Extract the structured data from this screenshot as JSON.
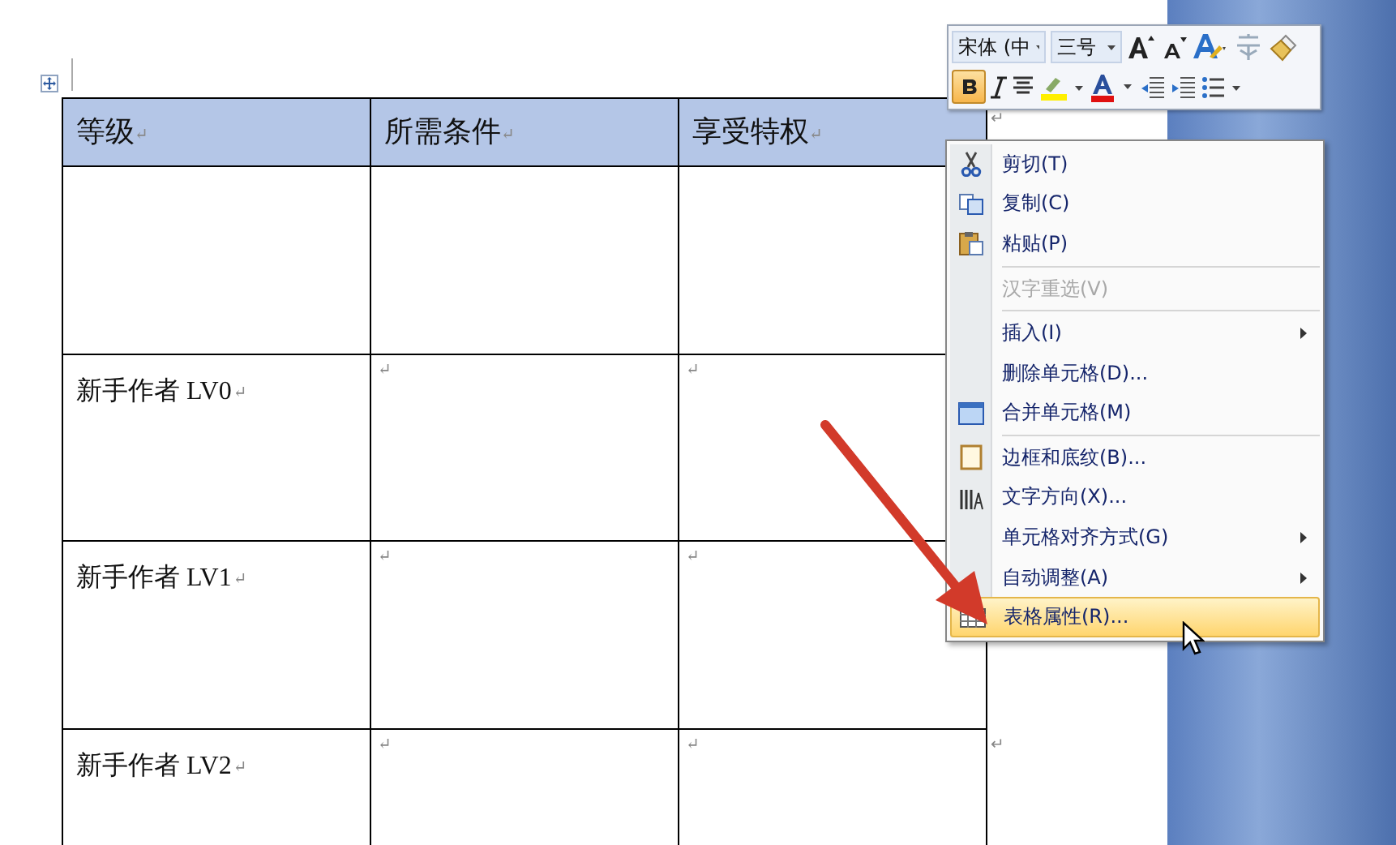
{
  "table": {
    "header": [
      {
        "text": "等级",
        "mark": "↵"
      },
      {
        "text": "所需条件",
        "mark": "↵"
      },
      {
        "text": "享受特权",
        "mark": "↵"
      }
    ],
    "rows": [
      {
        "cells": [
          {},
          {},
          {}
        ]
      },
      {
        "cells": [
          {
            "text": "新手作者 LV0",
            "mark": "↵"
          },
          {
            "mark": "↵"
          },
          {
            "mark": "↵"
          }
        ]
      },
      {
        "cells": [
          {
            "text": "新手作者 LV1",
            "mark": "↵"
          },
          {
            "mark": "↵"
          },
          {
            "mark": "↵"
          }
        ]
      },
      {
        "cells": [
          {
            "text": "新手作者 LV2",
            "mark": "↵"
          },
          {
            "mark": "↵"
          },
          {
            "mark": "↵"
          }
        ],
        "end_mark": "↵"
      }
    ],
    "header_end_mark": "↵"
  },
  "mini_toolbar": {
    "font": "宋体 (中",
    "size": "三号",
    "bold": true
  },
  "context_menu": {
    "items": [
      {
        "kind": "item",
        "label": "剪切(T)",
        "disabled": false,
        "submenu": false,
        "selected": false
      },
      {
        "kind": "item",
        "label": "复制(C)",
        "disabled": false,
        "submenu": false,
        "selected": false
      },
      {
        "kind": "item",
        "label": "粘贴(P)",
        "disabled": false,
        "submenu": false,
        "selected": false
      },
      {
        "kind": "separator"
      },
      {
        "kind": "item",
        "label": "汉字重选(V)",
        "disabled": true,
        "submenu": false,
        "selected": false
      },
      {
        "kind": "separator"
      },
      {
        "kind": "item",
        "label": "插入(I)",
        "disabled": false,
        "submenu": true,
        "selected": false
      },
      {
        "kind": "item",
        "label": "删除单元格(D)...",
        "disabled": false,
        "submenu": false,
        "selected": false
      },
      {
        "kind": "item",
        "label": "合并单元格(M)",
        "disabled": false,
        "submenu": false,
        "selected": false
      },
      {
        "kind": "separator"
      },
      {
        "kind": "item",
        "label": "边框和底纹(B)...",
        "disabled": false,
        "submenu": false,
        "selected": false
      },
      {
        "kind": "item",
        "label": "文字方向(X)...",
        "disabled": false,
        "submenu": false,
        "selected": false
      },
      {
        "kind": "item",
        "label": "单元格对齐方式(G)",
        "disabled": false,
        "submenu": true,
        "selected": false
      },
      {
        "kind": "item",
        "label": "自动调整(A)",
        "disabled": false,
        "submenu": true,
        "selected": false
      },
      {
        "kind": "item",
        "label": "表格属性(R)...",
        "disabled": false,
        "submenu": false,
        "selected": true
      }
    ]
  }
}
